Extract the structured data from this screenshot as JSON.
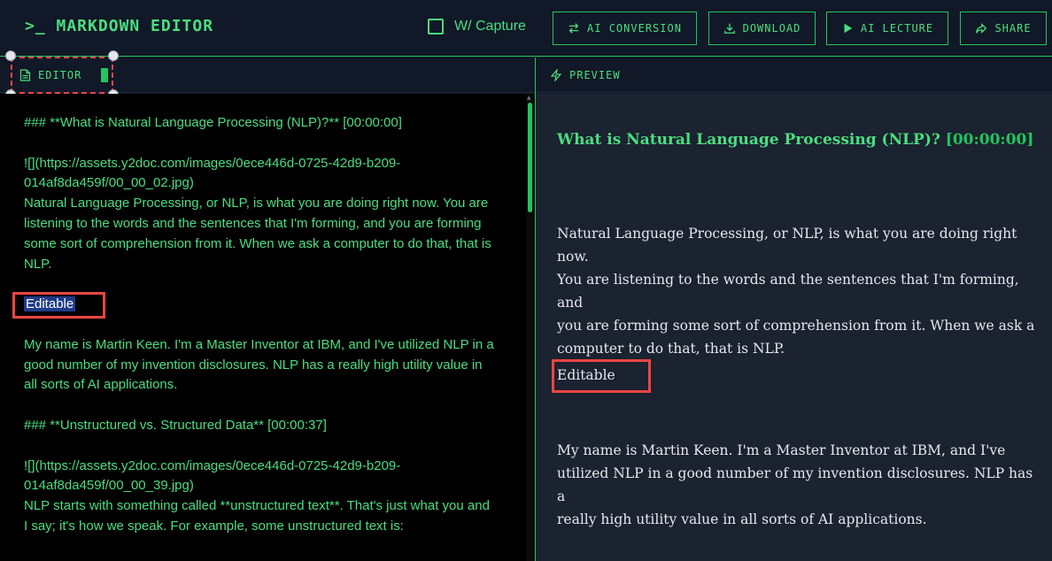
{
  "header": {
    "logo": ">_ MARKDOWN EDITOR",
    "capture_label": "W/ Capture",
    "buttons": {
      "ai_conversion": "AI CONVERSION",
      "download": "DOWNLOAD",
      "ai_lecture": "AI LECTURE",
      "share": "SHARE"
    }
  },
  "editor": {
    "tab_label": "EDITOR",
    "lines": {
      "h1": "### **What is Natural Language Processing (NLP)?** [00:00:00]",
      "img1a": "![](https://assets.y2doc.com/images/0ece446d-0725-42d9-b209-",
      "img1b": "014af8da459f/00_00_02.jpg)",
      "p1a": "Natural Language Processing, or NLP, is what you are doing right now. You are",
      "p1b": "listening to the words and the sentences that I'm forming, and you are forming",
      "p1c": "some sort of comprehension from it. When we ask a computer to do that, that is",
      "p1d": "NLP.",
      "editable": "Editable",
      "p2a": "My name is Martin Keen. I'm a Master Inventor at IBM, and I've utilized NLP in a",
      "p2b": "good number of my invention disclosures. NLP has a really high utility value in",
      "p2c": "all sorts of AI applications.",
      "h2": "### **Unstructured vs. Structured Data** [00:00:37]",
      "img2a": "![](https://assets.y2doc.com/images/0ece446d-0725-42d9-b209-",
      "img2b": "014af8da459f/00_00_39.jpg)",
      "p3a": "NLP starts with something called **unstructured text**. That's just what you and",
      "p3b": "I say; it's how we speak. For example, some unstructured text is:"
    }
  },
  "preview": {
    "tab_label": "PREVIEW",
    "heading": "What is Natural Language Processing (NLP)?",
    "heading_ts": "[00:00:00]",
    "p1a": "Natural Language Processing, or NLP, is what you are doing right now.",
    "p1b": "You are listening to the words and the sentences that I'm forming, and",
    "p1c": "you are forming some sort of comprehension from it. When we ask a",
    "p1d": "computer to do that, that is NLP.",
    "editable": "Editable",
    "p2a": "My name is Martin Keen. I'm a Master Inventor at IBM, and I've",
    "p2b": "utilized NLP in a good number of my invention disclosures. NLP has a",
    "p2c": "really high utility value in all sorts of AI applications."
  },
  "colors": {
    "accent": "#4ade80",
    "border": "#22c55e",
    "highlight_box": "#ef4444",
    "background": "#111827",
    "editor_bg": "#000000"
  },
  "icons": {
    "ai_conversion": "swap-arrows-icon",
    "download": "download-icon",
    "ai_lecture": "play-icon",
    "share": "share-arrow-icon",
    "editor_tab": "document-icon",
    "preview_tab": "lightning-icon"
  }
}
